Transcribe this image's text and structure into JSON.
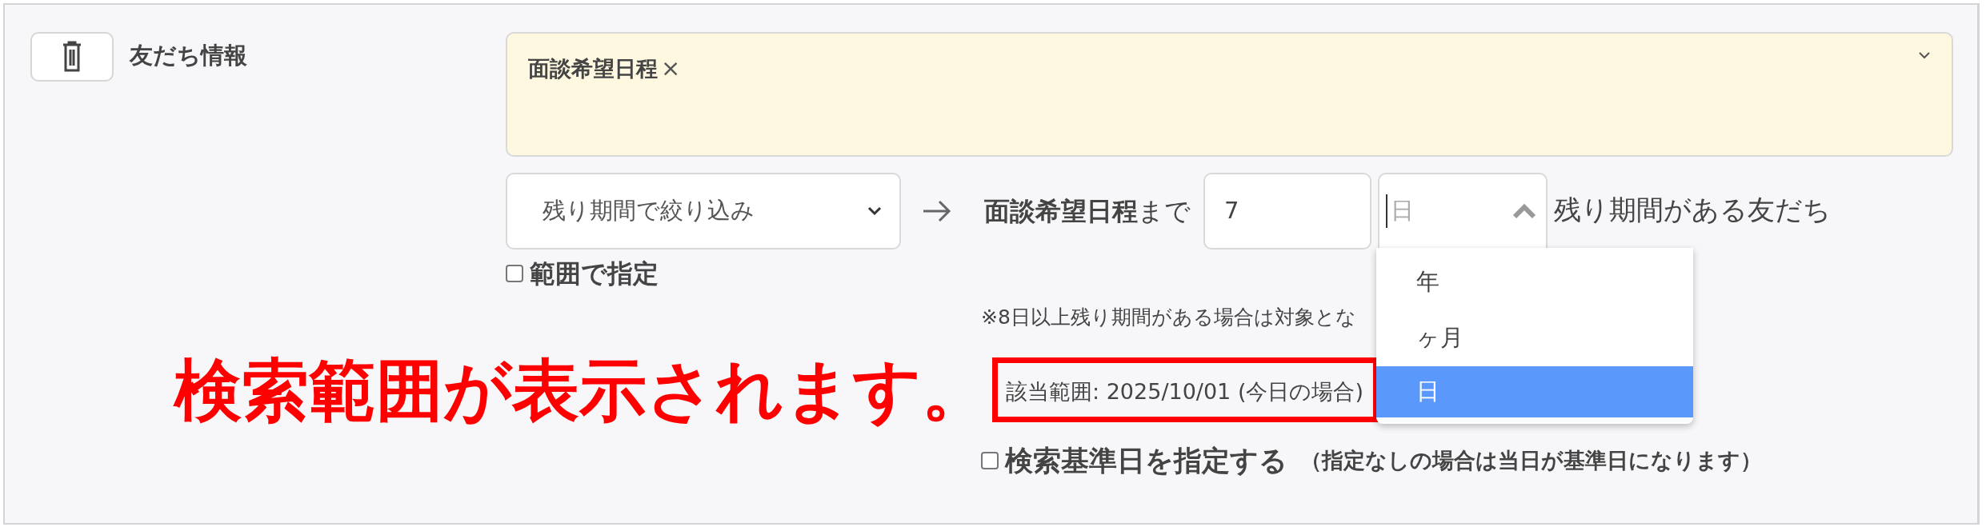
{
  "section_label": "友だち情報",
  "tag_field": {
    "tags": [
      {
        "label": "面談希望日程",
        "remove": "×"
      }
    ]
  },
  "filter_select": {
    "value": "残り期間で絞り込み"
  },
  "target_label": "**面談希望日程**まで",
  "amount_field": {
    "value": "7"
  },
  "unit_select": {
    "placeholder": "日",
    "expanded": true,
    "options": [
      {
        "label": "年",
        "selected": false
      },
      {
        "label": "ヶ月",
        "selected": false
      },
      {
        "label": "日",
        "selected": true
      }
    ]
  },
  "suffix": "残り期間がある友だち",
  "range_option": {
    "label": "範囲で指定",
    "checked": false
  },
  "note": "※8日以上残り期間がある場合は対象とな",
  "annotation": "検索範囲が表示されます。",
  "result": "該当範囲: 2025/10/01 (今日の場合)",
  "base_date_option": {
    "label": "検索基準日を指定する",
    "checked": false,
    "hint": "（指定なしの場合は当日が基準日になります）"
  }
}
